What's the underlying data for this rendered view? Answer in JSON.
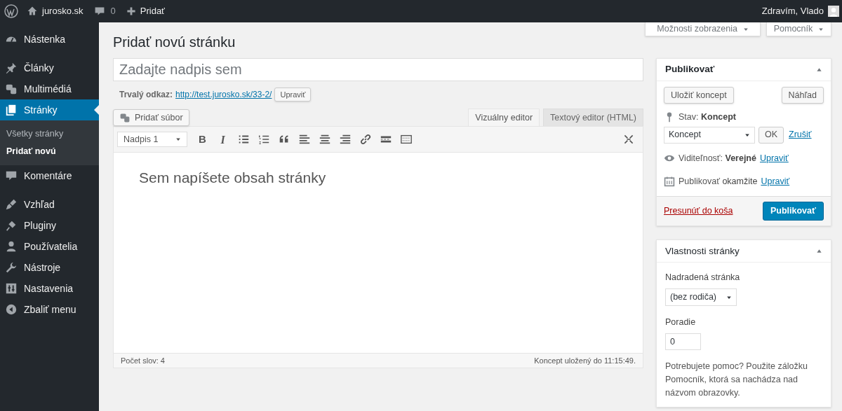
{
  "admin_bar": {
    "site": "jurosko.sk",
    "comments": "0",
    "new": "Pridať",
    "greeting": "Zdravím, Vlado"
  },
  "sidebar": {
    "groups": [
      [
        {
          "label": "Nástenka",
          "selected": false
        }
      ],
      [
        {
          "label": "Články",
          "selected": false
        },
        {
          "label": "Multimédiá",
          "selected": false
        },
        {
          "label": "Stránky",
          "selected": true,
          "children": [
            {
              "label": "Všetky stránky",
              "selected": false
            },
            {
              "label": "Pridať novú",
              "selected": true
            }
          ]
        },
        {
          "label": "Komentáre",
          "selected": false
        }
      ],
      [
        {
          "label": "Vzhľad",
          "selected": false
        },
        {
          "label": "Pluginy",
          "selected": false
        },
        {
          "label": "Používatelia",
          "selected": false
        },
        {
          "label": "Nástroje",
          "selected": false
        },
        {
          "label": "Nastavenia",
          "selected": false
        },
        {
          "label": "Zbaliť menu",
          "selected": false
        }
      ]
    ]
  },
  "screen_tabs": [
    "Možnosti zobrazenia",
    "Pomocník"
  ],
  "page_title": "Pridať novú stránku",
  "title_field": {
    "placeholder": "Zadajte nadpis sem"
  },
  "permalink": {
    "label": "Trvalý odkaz:",
    "url": "http://test.jurosko.sk/33-2/",
    "edit": "Upraviť"
  },
  "add_media": "Pridať súbor",
  "editor_tabs": [
    {
      "label": "Vizuálny editor",
      "selected": true
    },
    {
      "label": "Textový editor (HTML)",
      "selected": false
    }
  ],
  "toolbar": {
    "format": "Nadpis 1",
    "bold": "B",
    "italic": "I"
  },
  "editor": {
    "placeholder": "Sem napíšete obsah stránky"
  },
  "status_bar": {
    "word_count": "Počet slov: 4",
    "saved": "Koncept uložený do 11:15:49."
  },
  "publish_box": {
    "title": "Publikovať",
    "save_draft": "Uložiť koncept",
    "preview": "Náhľad",
    "status_label": "Stav:",
    "status_value": "Koncept",
    "status_select": "Koncept",
    "ok": "OK",
    "cancel": "Zrušiť",
    "visibility_label": "Viditeľnosť:",
    "visibility_value": "Verejné",
    "visibility_edit": "Upraviť",
    "schedule_label": "Publikovať",
    "schedule_value": "okamžite",
    "schedule_edit": "Upraviť",
    "trash": "Presunúť do koša",
    "publish": "Publikovať"
  },
  "attributes_box": {
    "title": "Vlastnosti stránky",
    "parent_label": "Nadradená stránka",
    "parent_value": "(bez rodiča)",
    "order_label": "Poradie",
    "order_value": "0",
    "help": "Potrebujete pomoc? Použite záložku Pomocník, ktorá sa nachádza nad názvom obrazovky."
  }
}
